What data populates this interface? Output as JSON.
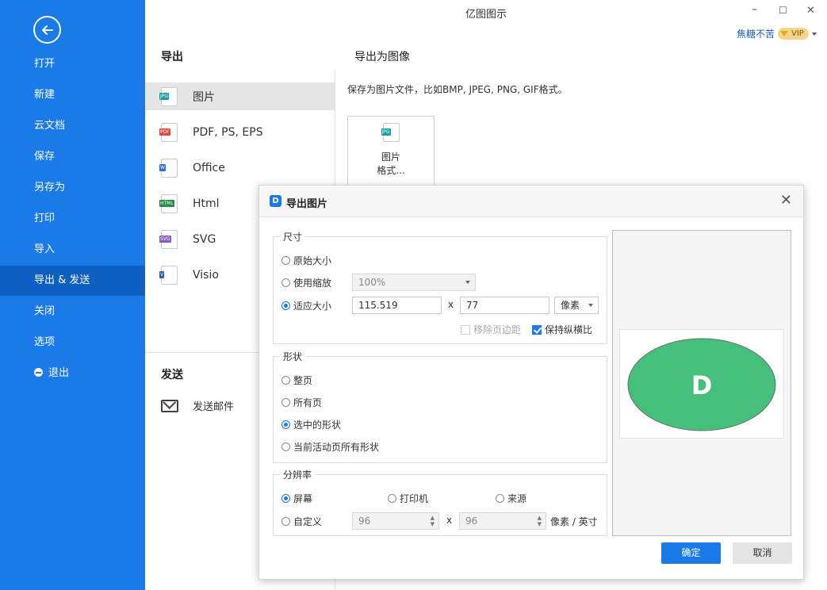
{
  "window": {
    "title": "亿图图示",
    "minimize": "–",
    "maximize": "☐",
    "close": "✕",
    "user_name": "焦糖不苦",
    "vip_label": "VIP"
  },
  "sidebar": {
    "items": [
      {
        "label": "打开"
      },
      {
        "label": "新建"
      },
      {
        "label": "云文档"
      },
      {
        "label": "保存"
      },
      {
        "label": "另存为"
      },
      {
        "label": "打印"
      },
      {
        "label": "导入"
      },
      {
        "label": "导出 & 发送",
        "active": true
      },
      {
        "label": "关闭"
      },
      {
        "label": "选项"
      },
      {
        "label": "退出"
      }
    ]
  },
  "export": {
    "heading": "导出",
    "items": [
      {
        "label": "图片",
        "tag": "JPG",
        "color": "#19a0a0",
        "active": true
      },
      {
        "label": "PDF, PS, EPS",
        "tag": "PDF",
        "color": "#e0473d"
      },
      {
        "label": "Office",
        "tag": "W",
        "color": "#2b6fd6"
      },
      {
        "label": "Html",
        "tag": "HTML",
        "color": "#2a8a4a"
      },
      {
        "label": "SVG",
        "tag": "SVG",
        "color": "#8a5bc8"
      },
      {
        "label": "Visio",
        "tag": "V",
        "color": "#2b5bbf"
      }
    ],
    "send_heading": "发送",
    "send_email": "发送邮件"
  },
  "panel": {
    "heading": "导出为图像",
    "description": "保存为图片文件，比如BMP, JPEG, PNG, GIF格式。",
    "card_tag": "JPG",
    "card_line1": "图片",
    "card_line2": "格式..."
  },
  "dialog": {
    "title": "导出图片",
    "close": "✕",
    "size": {
      "legend": "尺寸",
      "original": "原始大小",
      "use_zoom": "使用缩放",
      "zoom_value": "100%",
      "fit": "适应大小",
      "width": "115.519",
      "times": "x",
      "height": "77",
      "unit": "像素",
      "remove_margin": "移除页边距",
      "keep_ratio": "保持纵横比"
    },
    "shape": {
      "legend": "形状",
      "whole_page": "整页",
      "all_pages": "所有页",
      "selected": "选中的形状",
      "active_page_all": "当前活动页所有形状"
    },
    "resolution": {
      "legend": "分辨率",
      "screen": "屏幕",
      "printer": "打印机",
      "source": "来源",
      "custom": "自定义",
      "x_value": "96",
      "times": "x",
      "y_value": "96",
      "unit": "像素 / 英寸"
    },
    "preview": {
      "shape_letter": "D",
      "shape_color": "#45c07a"
    },
    "ok": "确定",
    "cancel": "取消"
  }
}
